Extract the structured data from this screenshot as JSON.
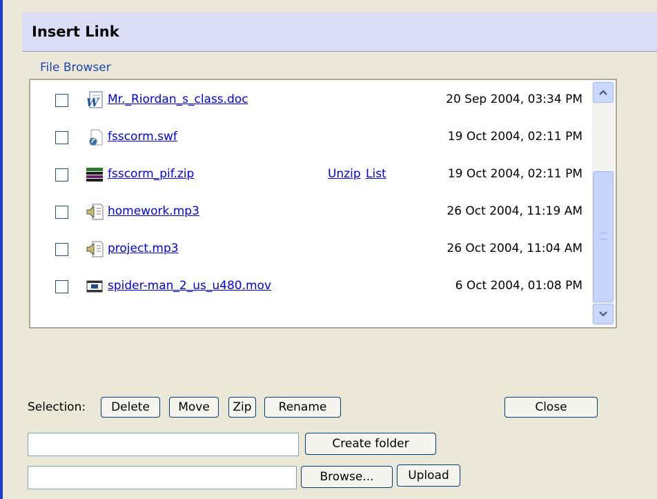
{
  "dialog": {
    "title": "Insert Link",
    "section_label": "File Browser"
  },
  "files": [
    {
      "name": "Mr._Riordan_s_class.doc",
      "date": "20 Sep 2004, 03:34 PM",
      "icon": "word-doc-icon"
    },
    {
      "name": "fsscorm.swf",
      "date": "19 Oct 2004, 02:11 PM",
      "icon": "flash-file-icon"
    },
    {
      "name": "fsscorm_pif.zip",
      "date": "19 Oct 2004, 02:11 PM",
      "icon": "zip-archive-icon",
      "actions": [
        "Unzip",
        "List"
      ]
    },
    {
      "name": "homework.mp3",
      "date": "26 Oct 2004, 11:19 AM",
      "icon": "audio-file-icon"
    },
    {
      "name": "project.mp3",
      "date": "26 Oct 2004, 11:04 AM",
      "icon": "audio-file-icon"
    },
    {
      "name": "spider-man_2_us_u480.mov",
      "date": "6 Oct 2004, 01:08 PM",
      "icon": "video-file-icon"
    }
  ],
  "selection": {
    "label": "Selection:",
    "buttons": [
      "Delete",
      "Move",
      "Zip",
      "Rename"
    ]
  },
  "close_label": "Close",
  "create_folder": {
    "value": "",
    "button": "Create folder"
  },
  "upload": {
    "value": "",
    "browse": "Browse...",
    "button": "Upload"
  },
  "colors": {
    "header_bg": "#dcdcf7",
    "link": "#0000ee",
    "accent_bar": "#1f3fd0"
  }
}
